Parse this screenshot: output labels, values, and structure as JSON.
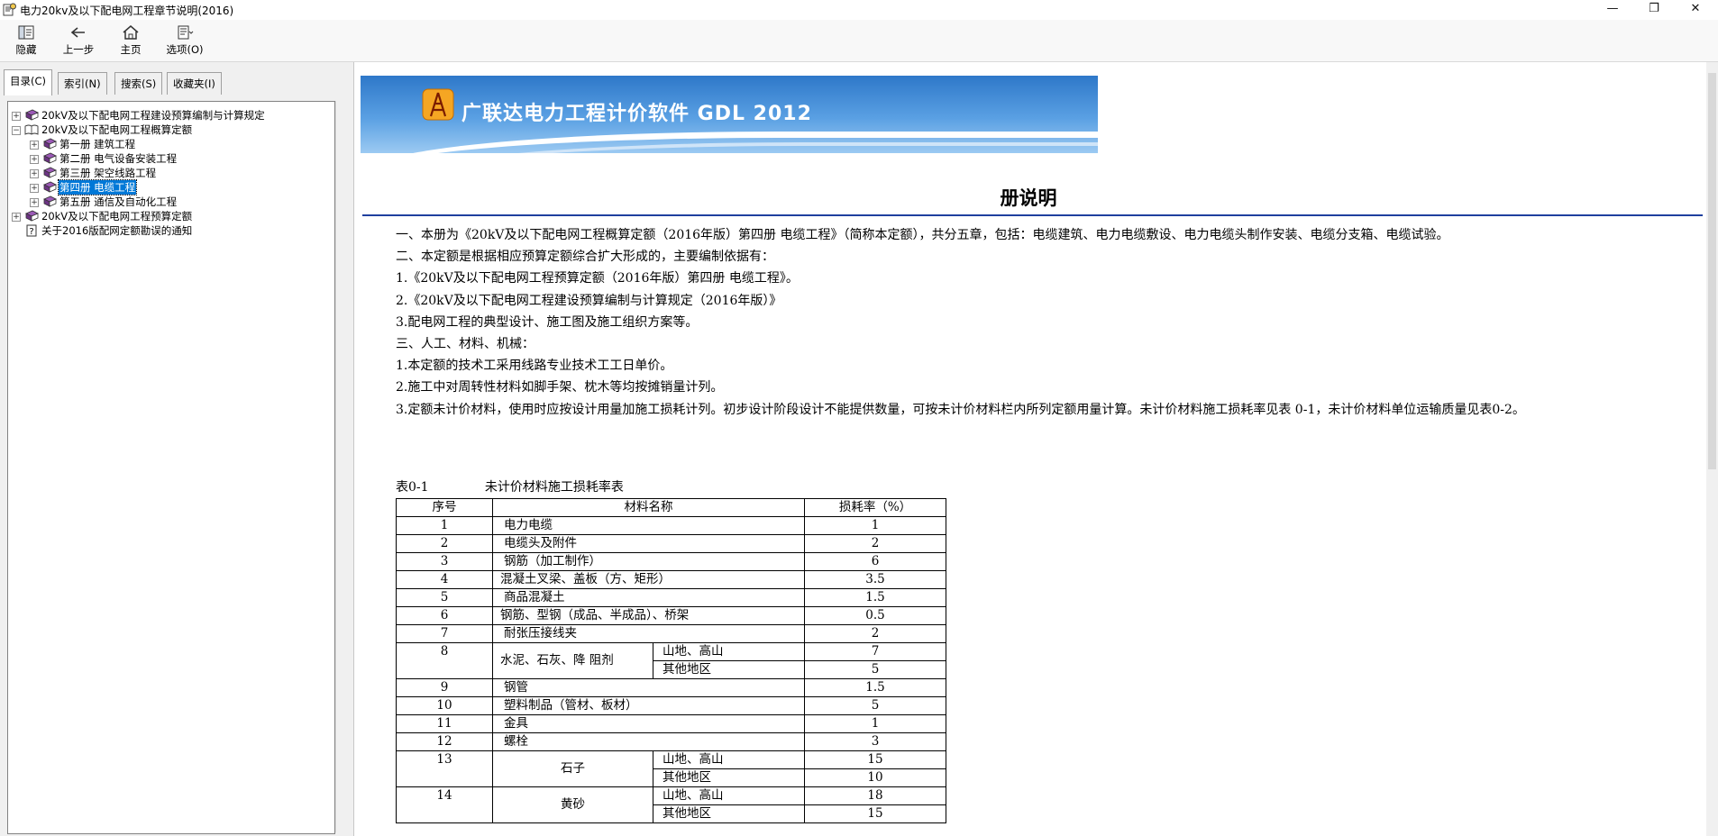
{
  "window": {
    "title": "电力20kv及以下配电网工程章节说明(2016)",
    "controls": [
      "—",
      "❐",
      "✕"
    ]
  },
  "toolbar": [
    {
      "label": "隐藏",
      "icon": "hide-pane-icon"
    },
    {
      "label": "上一步",
      "icon": "back-arrow-icon"
    },
    {
      "label": "主页",
      "icon": "home-icon"
    },
    {
      "label": "选项(O)",
      "icon": "options-icon"
    }
  ],
  "tabs": [
    "目录(C)",
    "索引(N)",
    "搜索(S)",
    "收藏夹(I)"
  ],
  "tree": [
    {
      "label": "20kV及以下配电网工程建设预算编制与计算规定",
      "level": 0,
      "expander": "+",
      "icon": "book-closed-icon",
      "selected": false
    },
    {
      "label": "20kV及以下配电网工程概算定额",
      "level": 0,
      "expander": "−",
      "icon": "book-open-icon",
      "selected": false
    },
    {
      "label": "第一册  建筑工程",
      "level": 1,
      "expander": "+",
      "icon": "book-closed-icon",
      "selected": false
    },
    {
      "label": "第二册  电气设备安装工程",
      "level": 1,
      "expander": "+",
      "icon": "book-closed-icon",
      "selected": false
    },
    {
      "label": "第三册  架空线路工程",
      "level": 1,
      "expander": "+",
      "icon": "book-closed-icon",
      "selected": false
    },
    {
      "label": "第四册  电缆工程",
      "level": 1,
      "expander": "+",
      "icon": "book-closed-icon",
      "selected": true
    },
    {
      "label": "第五册  通信及自动化工程",
      "level": 1,
      "expander": "+",
      "icon": "book-closed-icon",
      "selected": false
    },
    {
      "label": "20kV及以下配电网工程预算定额",
      "level": 0,
      "expander": "+",
      "icon": "book-closed-icon",
      "selected": false
    },
    {
      "label": "关于2016版配网定额勘误的通知",
      "level": 0,
      "expander": "",
      "icon": "help-page-icon",
      "selected": false
    }
  ],
  "banner": {
    "title": "广联达电力工程计价软件 GDL 2012"
  },
  "document": {
    "heading": "册说明",
    "paragraphs": [
      "一、本册为《20kV及以下配电网工程概算定额（2016年版）第四册 电缆工程》（简称本定额），共分五章，包括：电缆建筑、电力电缆敷设、电力电缆头制作安装、电缆分支箱、电缆试验。",
      "二、本定额是根据相应预算定额综合扩大形成的，主要编制依据有：",
      "1.《20kV及以下配电网工程预算定额（2016年版）第四册 电缆工程》。",
      "2.《20kV及以下配电网工程建设预算编制与计算规定（2016年版）》",
      "3.配电网工程的典型设计、施工图及施工组织方案等。",
      "三、人工、材料、机械：",
      "1.本定额的技术工采用线路专业技术工工日单价。",
      "2.施工中对周转性材料如脚手架、枕木等均按摊销量计列。",
      "3.定额未计价材料，使用时应按设计用量加施工损耗计列。初步设计阶段设计不能提供数量，可按未计价材料栏内所列定额用量计算。未计价材料施工损耗率见表 0-1，未计价材料单位运输质量见表0-2。"
    ],
    "table": {
      "caption_no": "表0-1",
      "caption_title": "未计价材料施工损耗率表",
      "headers": [
        "序号",
        "材料名称",
        "损耗率（%）"
      ],
      "rows": [
        {
          "no": "1",
          "name": "电力电缆",
          "rate": "1"
        },
        {
          "no": "2",
          "name": "电缆头及附件",
          "rate": "2"
        },
        {
          "no": "3",
          "name": "钢筋（加工制作）",
          "rate": "6"
        },
        {
          "no": "4",
          "name": "混凝土叉梁、盖板（方、矩形）",
          "rate": "3.5"
        },
        {
          "no": "5",
          "name": "商品混凝土",
          "rate": "1.5"
        },
        {
          "no": "6",
          "name": "钢筋、型钢（成品、半成品）、桥架",
          "rate": "0.5"
        },
        {
          "no": "7",
          "name": "耐张压接线夹",
          "rate": "2"
        },
        {
          "no": "8",
          "name": "水泥、石灰、降 阻剂",
          "subs": [
            {
              "area": "山地、高山",
              "rate": "7"
            },
            {
              "area": "其他地区",
              "rate": "5"
            }
          ]
        },
        {
          "no": "9",
          "name": "钢管",
          "rate": "1.5"
        },
        {
          "no": "10",
          "name": "塑料制品（管材、板材）",
          "rate": "5"
        },
        {
          "no": "11",
          "name": "金具",
          "rate": "1"
        },
        {
          "no": "12",
          "name": "螺栓",
          "rate": "3"
        },
        {
          "no": "13",
          "name": "石子",
          "subs": [
            {
              "area": "山地、高山",
              "rate": "15"
            },
            {
              "area": "其他地区",
              "rate": "10"
            }
          ]
        },
        {
          "no": "14",
          "name": "黄砂",
          "subs": [
            {
              "area": "山地、高山",
              "rate": "18"
            },
            {
              "area": "其他地区",
              "rate": "15"
            }
          ]
        }
      ]
    }
  }
}
